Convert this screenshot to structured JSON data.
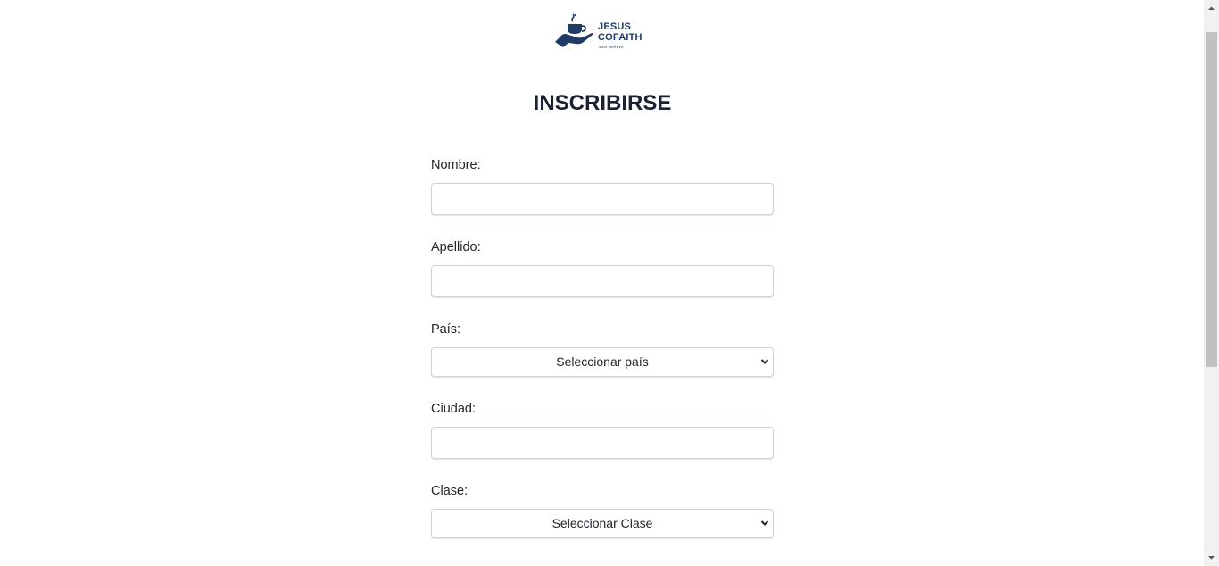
{
  "header": {
    "logo_line1": "JESUS",
    "logo_line2": "COFAITH",
    "logo_tagline": "Just Believe",
    "logo_icon": "hand-holding-coffee-cup-icon"
  },
  "form": {
    "title": "INSCRIBIRSE",
    "fields": {
      "nombre": {
        "label": "Nombre:",
        "value": ""
      },
      "apellido": {
        "label": "Apellido:",
        "value": ""
      },
      "pais": {
        "label": "País:",
        "selected": "Seleccionar país"
      },
      "ciudad": {
        "label": "Ciudad:",
        "value": ""
      },
      "clase": {
        "label": "Clase:",
        "selected": "Seleccionar Clase"
      }
    }
  },
  "colors": {
    "brand": "#1f3b66",
    "title": "#1b2233",
    "input_border": "#ced4da"
  }
}
